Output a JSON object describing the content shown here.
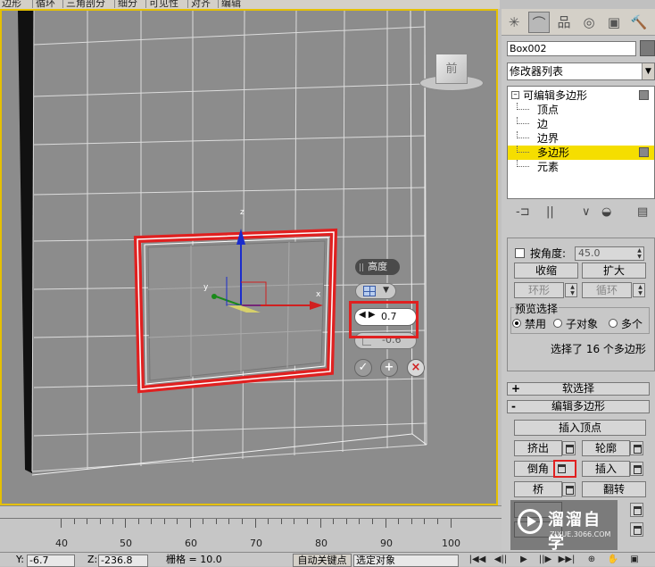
{
  "menubar": {
    "items": [
      "边形",
      "循环",
      "三角剖分",
      "细分",
      "可见性",
      "对齐",
      "编辑"
    ]
  },
  "viewport": {
    "viewcube_label": "前",
    "gizmo": {
      "x_label": "x",
      "y_label": "y",
      "z_label": "z"
    }
  },
  "caddy": {
    "title": "高度",
    "height_value": "0.7",
    "outline_value": "-0.6",
    "ok_symbol": "✓",
    "apply_symbol": "+",
    "cancel_symbol": "×"
  },
  "command_panel": {
    "tabs": [
      "create-icon",
      "modify-icon",
      "hierarchy-icon",
      "motion-icon",
      "display-icon",
      "utilities-icon"
    ],
    "object_name": "Box002",
    "modifier_list": "修改器列表",
    "stack": {
      "root": "可编辑多边形",
      "items": [
        "顶点",
        "边",
        "边界",
        "多边形",
        "元素"
      ],
      "selected_index": 3
    }
  },
  "selection_rollout": {
    "by_angle_label": "按角度:",
    "by_angle_value": "45.0",
    "shrink": "收缩",
    "grow": "扩大",
    "ring": "环形",
    "loop": "循环",
    "preview_title": "预览选择",
    "preview_options": [
      "禁用",
      "子对象",
      "多个"
    ],
    "preview_selected": 0,
    "status": "选择了 16 个多边形"
  },
  "soft_selection": {
    "sign": "+",
    "title": "软选择"
  },
  "edit_polygons": {
    "sign": "-",
    "title": "编辑多边形",
    "insert_vertex": "插入顶点",
    "extrude": "挤出",
    "outline": "轮廓",
    "bevel": "倒角",
    "inset": "插入",
    "bridge": "桥",
    "flip": "翻转"
  },
  "timeline": {
    "labels": [
      "40",
      "50",
      "60",
      "70",
      "80",
      "90",
      "100"
    ]
  },
  "statusbar": {
    "y_label": "Y:",
    "y_value": "-6.7",
    "z_label": "Z:",
    "z_value": "-236.8",
    "grid_label": "栅格 = 10.0",
    "auto_key": "自动关键点",
    "set_key_dropdown": "选定对象"
  },
  "watermark": {
    "name": "溜溜自学",
    "url": "ZIXUE.3066.COM"
  },
  "colors": {
    "selection_red": "#e02020",
    "active_yellow": "#f5de00",
    "viewport_bg": "#8c8c8c"
  }
}
